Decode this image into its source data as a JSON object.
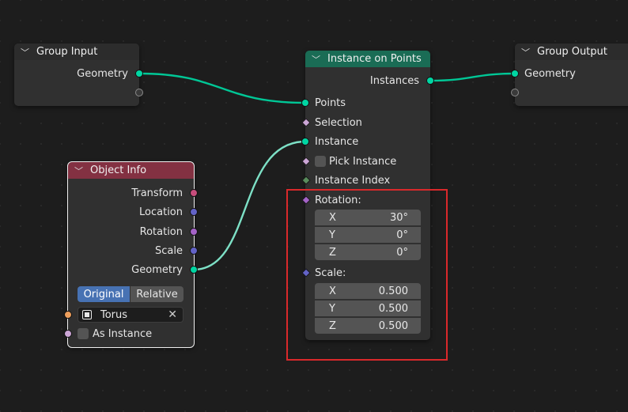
{
  "group_input": {
    "title": "Group Input",
    "geometry_label": "Geometry"
  },
  "group_output": {
    "title": "Group Output",
    "geometry_label": "Geometry"
  },
  "instance_on_points": {
    "title": "Instance on Points",
    "header_color": "#1a6c55",
    "output_instances": "Instances",
    "inputs": {
      "points": "Points",
      "selection": "Selection",
      "instance": "Instance",
      "pick_instance": "Pick Instance",
      "instance_index": "Instance Index",
      "rotation": "Rotation:",
      "scale": "Scale:"
    },
    "rotation": {
      "x_label": "X",
      "x": "30°",
      "y_label": "Y",
      "y": "0°",
      "z_label": "Z",
      "z": "0°"
    },
    "scale": {
      "x_label": "X",
      "x": "0.500",
      "y_label": "Y",
      "y": "0.500",
      "z_label": "Z",
      "z": "0.500"
    }
  },
  "object_info": {
    "title": "Object Info",
    "header_color": "#833142",
    "outputs": {
      "transform": "Transform",
      "location": "Location",
      "rotation": "Rotation",
      "scale": "Scale",
      "geometry": "Geometry"
    },
    "mode_original": "Original",
    "mode_relative": "Relative",
    "object": "Torus",
    "as_instance": "As Instance"
  },
  "colors": {
    "geometry_socket": "#00d6a3",
    "vector_socket": "#6363c7",
    "rotation_socket": "#a463c7",
    "matrix_socket": "#c74d7c",
    "bool_socket": "#cca6d6",
    "int_socket": "#598c5c",
    "object_socket": "#ed9e5c",
    "highlight_box": "#d9292b"
  }
}
